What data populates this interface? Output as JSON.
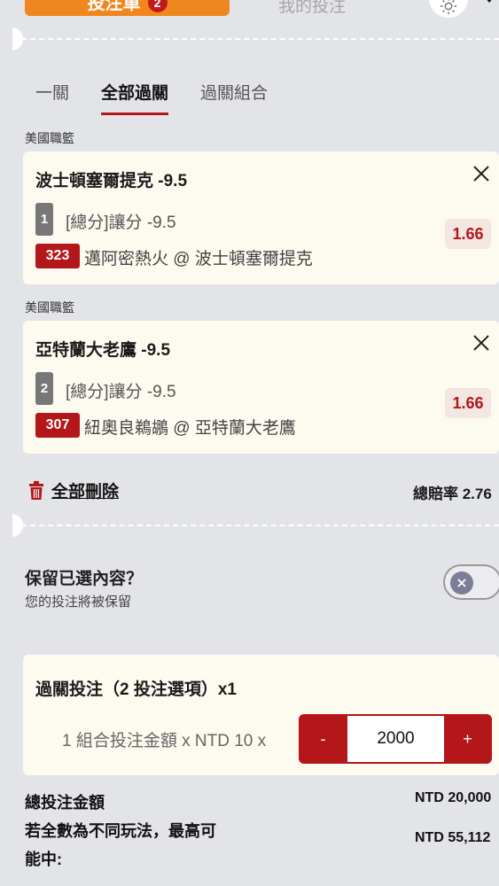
{
  "header": {
    "betslip_label": "投注單",
    "betslip_count": "2",
    "mybets_label": "我的投注"
  },
  "bet_types": [
    {
      "label": "一關",
      "active": false
    },
    {
      "label": "全部過關",
      "active": true
    },
    {
      "label": "過關組合",
      "active": false
    }
  ],
  "selections": [
    {
      "league": "美國職籃",
      "title": "波士頓塞爾提克 -9.5",
      "leg_no": "1",
      "market": "[總分]讓分 -9.5",
      "match_id": "323",
      "match": "邁阿密熱火 @ 波士頓塞爾提克",
      "odds": "1.66"
    },
    {
      "league": "美國職籃",
      "title": "亞特蘭大老鷹 -9.5",
      "leg_no": "2",
      "market": "[總分]讓分 -9.5",
      "match_id": "307",
      "match": "紐奧良鵜鶘 @ 亞特蘭大老鷹",
      "odds": "1.66"
    }
  ],
  "actions": {
    "delete_all": "全部刪除",
    "total_odds": "總賠率 2.76"
  },
  "keep": {
    "title": "保留已選內容？",
    "subtitle": "您的投注將被保留",
    "enabled": false
  },
  "parlay": {
    "title": "過關投注（2 投注選項）x1",
    "combo_label": "1 組合投注金額 x NTD 10 x",
    "minus": "-",
    "plus": "+",
    "amount": "2000"
  },
  "summary": {
    "total_label": "總投注金額",
    "total_value": "NTD 20,000",
    "max_label_1": "若全數為不同玩法，最高可",
    "max_label_2": "能中:",
    "max_value": "NTD 55,112"
  },
  "colors": {
    "accent": "#b3171a",
    "tab_orange": "#f0871e",
    "card_bg": "#fdfaf0",
    "page_bg": "#e3e4e8"
  }
}
